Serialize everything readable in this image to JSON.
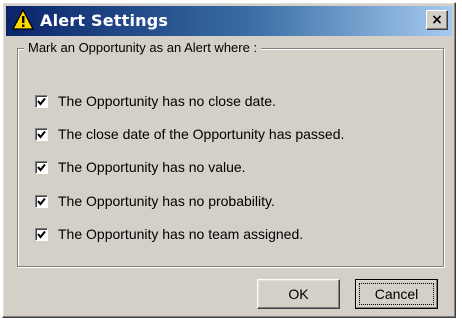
{
  "window": {
    "title": "Alert Settings",
    "close_glyph": "×",
    "title_icon": "warning-icon"
  },
  "group": {
    "legend": "Mark an Opportunity as an Alert where :",
    "options": [
      {
        "label": "The Opportunity has no close date.",
        "checked": true
      },
      {
        "label": "The close date of the Opportunity has passed.",
        "checked": true
      },
      {
        "label": "The Opportunity has no value.",
        "checked": true
      },
      {
        "label": "The Opportunity has no probability.",
        "checked": true
      },
      {
        "label": "The Opportunity has no team assigned.",
        "checked": true
      }
    ]
  },
  "buttons": {
    "ok_label": "OK",
    "cancel_label": "Cancel"
  },
  "colors": {
    "title_gradient_start": "#0a246a",
    "title_gradient_end": "#a6caf0",
    "face": "#d4d0c8",
    "warning_yellow": "#ffd800"
  }
}
